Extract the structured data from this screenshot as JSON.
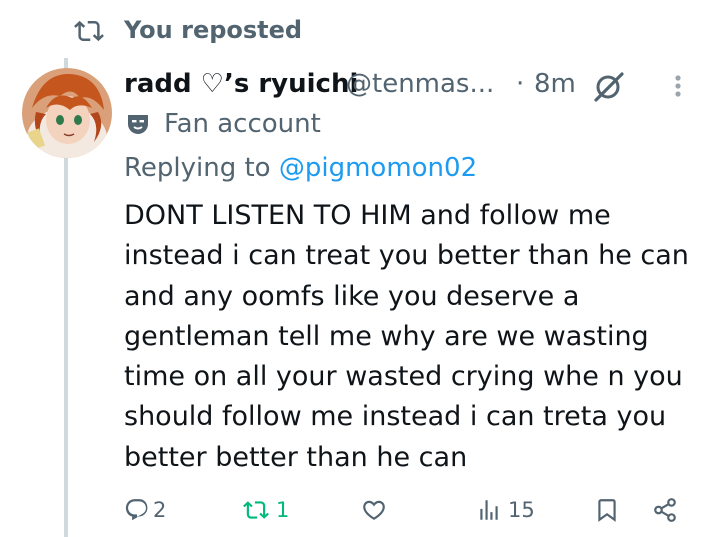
{
  "repost": {
    "icon": "repost-icon",
    "text": "You reposted"
  },
  "tweet": {
    "avatar": "avatar",
    "display_name": "radd ♡’s ryuichi",
    "handle": "@tenmas...",
    "separator": "·",
    "time": "8m",
    "grok_icon": "grok-icon",
    "more_icon": "more-icon",
    "badge": {
      "icon": "mask-icon",
      "text": "Fan account"
    },
    "replying_to_label": "Replying to",
    "replying_to_handle": "@pigmomon02",
    "body_lines": [
      "DONT LISTEN TO HIM and follow me",
      "instead i can treat you better than he can",
      "and any oomfs like you deserve a",
      "gentleman tell me why are we wasting",
      "time on all your wasted crying whe n you",
      "should follow me instead i can treta you",
      "better better than he can"
    ]
  },
  "actions": {
    "reply": {
      "icon": "reply-icon",
      "count": "2"
    },
    "repost": {
      "icon": "repost-icon",
      "count": "1",
      "active_color": "#00ba7c"
    },
    "like": {
      "icon": "heart-icon"
    },
    "views": {
      "icon": "views-icon",
      "count": "15"
    },
    "bookmark": {
      "icon": "bookmark-icon"
    },
    "share": {
      "icon": "share-icon"
    }
  },
  "colors": {
    "text": "#0f1419",
    "secondary": "#536471",
    "link": "#1d9bf0",
    "repost_green": "#00ba7c",
    "thread_line": "#cfd9de"
  }
}
